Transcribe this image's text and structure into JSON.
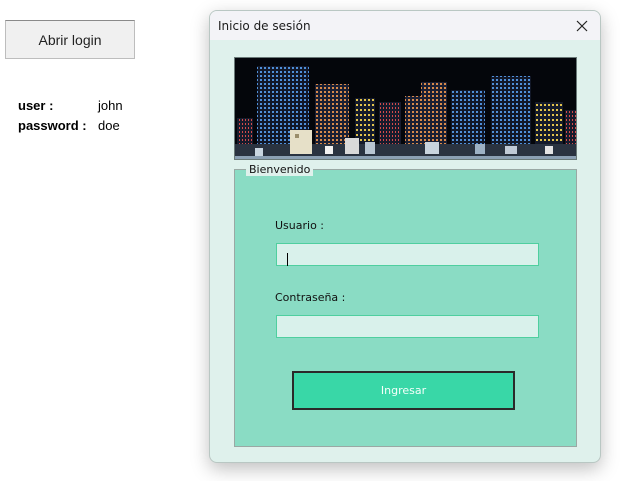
{
  "sheet": {
    "open_button_label": "Abrir login",
    "credentials": [
      {
        "key": "user :",
        "value": "john"
      },
      {
        "key": "password :",
        "value": "doe"
      }
    ]
  },
  "dialog": {
    "title": "Inicio de sesión",
    "group_label": "Bienvenido",
    "user_label": "Usuario :",
    "user_value": "",
    "password_label": "Contraseña :",
    "password_value": "",
    "submit_label": "Ingresar"
  }
}
